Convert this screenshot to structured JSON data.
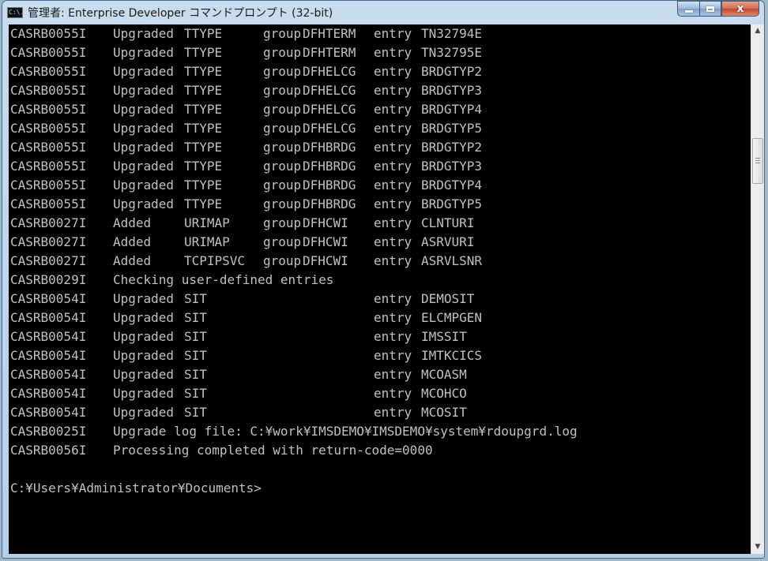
{
  "window": {
    "title": "管理者: Enterprise Developer コマンドプロンプト (32-bit)",
    "icon_text": "C:\\."
  },
  "captions": {
    "close_glyph": "x"
  },
  "console": {
    "lines": [
      [
        "CASRB0055I",
        "Upgraded",
        "TTYPE",
        "group",
        "DFHTERM",
        "entry",
        "TN32794E"
      ],
      [
        "CASRB0055I",
        "Upgraded",
        "TTYPE",
        "group",
        "DFHTERM",
        "entry",
        "TN32795E"
      ],
      [
        "CASRB0055I",
        "Upgraded",
        "TTYPE",
        "group",
        "DFHELCG",
        "entry",
        "BRDGTYP2"
      ],
      [
        "CASRB0055I",
        "Upgraded",
        "TTYPE",
        "group",
        "DFHELCG",
        "entry",
        "BRDGTYP3"
      ],
      [
        "CASRB0055I",
        "Upgraded",
        "TTYPE",
        "group",
        "DFHELCG",
        "entry",
        "BRDGTYP4"
      ],
      [
        "CASRB0055I",
        "Upgraded",
        "TTYPE",
        "group",
        "DFHELCG",
        "entry",
        "BRDGTYP5"
      ],
      [
        "CASRB0055I",
        "Upgraded",
        "TTYPE",
        "group",
        "DFHBRDG",
        "entry",
        "BRDGTYP2"
      ],
      [
        "CASRB0055I",
        "Upgraded",
        "TTYPE",
        "group",
        "DFHBRDG",
        "entry",
        "BRDGTYP3"
      ],
      [
        "CASRB0055I",
        "Upgraded",
        "TTYPE",
        "group",
        "DFHBRDG",
        "entry",
        "BRDGTYP4"
      ],
      [
        "CASRB0055I",
        "Upgraded",
        "TTYPE",
        "group",
        "DFHBRDG",
        "entry",
        "BRDGTYP5"
      ],
      [
        "CASRB0027I",
        "Added",
        "URIMAP",
        "group",
        "DFHCWI",
        "entry",
        "CLNTURI"
      ],
      [
        "CASRB0027I",
        "Added",
        "URIMAP",
        "group",
        "DFHCWI",
        "entry",
        "ASRVURI"
      ],
      [
        "CASRB0027I",
        "Added",
        "TCPIPSVC",
        "group",
        "DFHCWI",
        "entry",
        "ASRVLSNR"
      ],
      [
        "CASRB0029I",
        "Checking user-defined entries"
      ],
      [
        "CASRB0054I",
        "Upgraded",
        "SIT",
        "",
        "",
        "entry",
        "DEMOSIT"
      ],
      [
        "CASRB0054I",
        "Upgraded",
        "SIT",
        "",
        "",
        "entry",
        "ELCMPGEN"
      ],
      [
        "CASRB0054I",
        "Upgraded",
        "SIT",
        "",
        "",
        "entry",
        "IMSSIT"
      ],
      [
        "CASRB0054I",
        "Upgraded",
        "SIT",
        "",
        "",
        "entry",
        "IMTKCICS"
      ],
      [
        "CASRB0054I",
        "Upgraded",
        "SIT",
        "",
        "",
        "entry",
        "MCOASM"
      ],
      [
        "CASRB0054I",
        "Upgraded",
        "SIT",
        "",
        "",
        "entry",
        "MCOHCO"
      ],
      [
        "CASRB0054I",
        "Upgraded",
        "SIT",
        "",
        "",
        "entry",
        "MCOSIT"
      ],
      [
        "CASRB0025I",
        "Upgrade log file: C:¥work¥IMSDEMO¥IMSDEMO¥system¥rdoupgrd.log"
      ],
      [
        "CASRB0056I",
        "Processing completed with return-code=0000"
      ],
      [
        ""
      ],
      [
        "C:¥Users¥Administrator¥Documents>"
      ]
    ]
  },
  "scrollbar": {
    "up_glyph": "▲",
    "down_glyph": "▼",
    "position_fraction": 0.22
  }
}
